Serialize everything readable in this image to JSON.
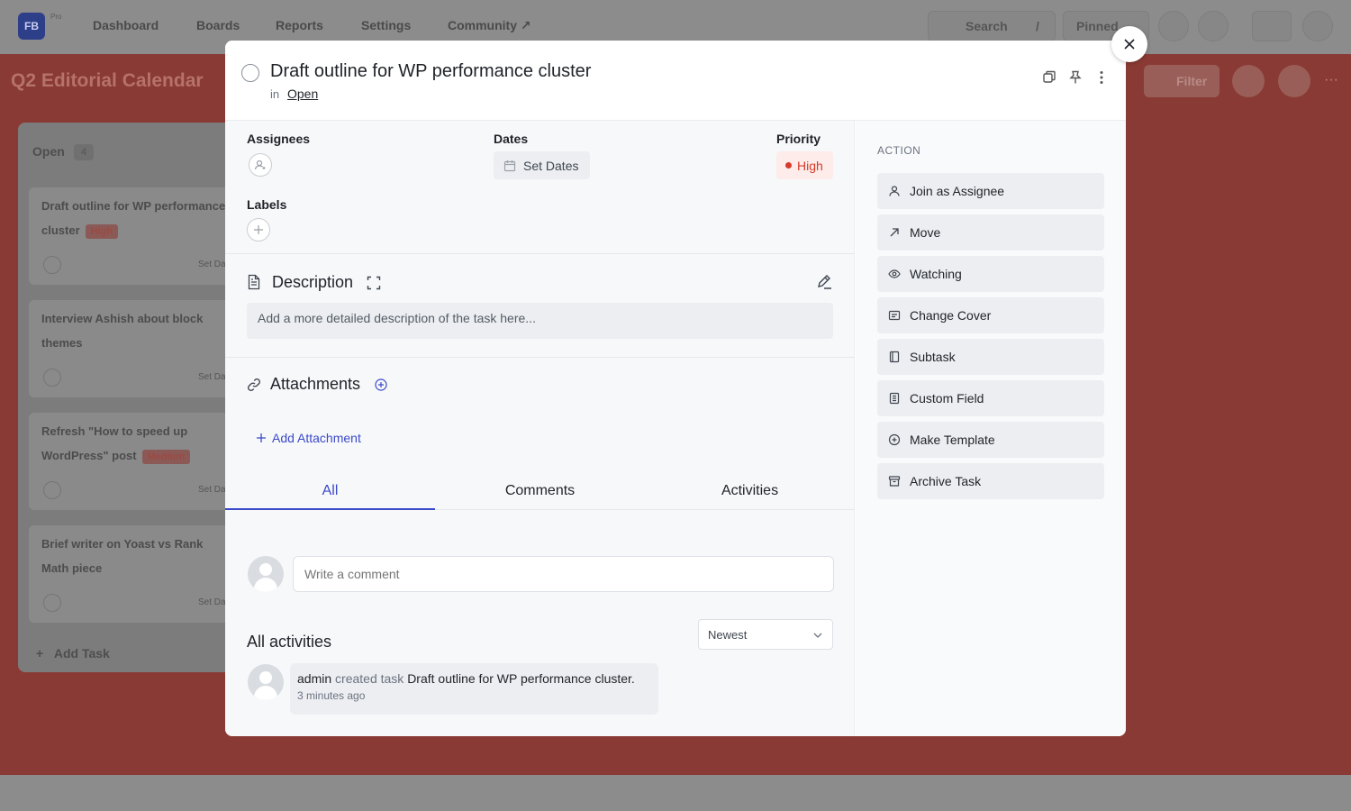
{
  "background": {
    "logo_pro": "Pro",
    "nav": [
      "Dashboard",
      "Boards",
      "Reports",
      "Settings",
      "Community ↗"
    ],
    "search_label": "Search",
    "search_shortcut": "/",
    "pinned_label": "Pinned",
    "board_title": "Q2 Editorial Calendar",
    "filter_label": "Filter",
    "column_title": "Open",
    "column_count": "4",
    "cards": [
      {
        "title": "Draft outline for WP performance cluster",
        "tag": "High"
      },
      {
        "title": "Interview Ashish about block themes",
        "tag": ""
      },
      {
        "title": "Refresh \"How to speed up WordPress\" post",
        "tag": "Medium"
      },
      {
        "title": "Brief writer on Yoast vs Rank Math piece",
        "tag": ""
      }
    ],
    "card_set_dates": "Set Da",
    "add_task": "Add Task"
  },
  "task": {
    "title": "Draft outline for WP performance cluster",
    "in_label": "in",
    "stage": "Open"
  },
  "fields": {
    "assignees_label": "Assignees",
    "dates_label": "Dates",
    "set_dates": "Set Dates",
    "priority_label": "Priority",
    "priority_value": "High",
    "labels_label": "Labels"
  },
  "description": {
    "title": "Description",
    "placeholder": "Add a more detailed description of the task here..."
  },
  "attachments": {
    "title": "Attachments",
    "add_label": "Add Attachment"
  },
  "tabs": [
    "All",
    "Comments",
    "Activities"
  ],
  "comment": {
    "placeholder": "Write a comment"
  },
  "activities": {
    "title": "All activities",
    "sort": "Newest",
    "items": [
      {
        "user": "admin",
        "verb": "created task",
        "target": "Draft outline for WP performance cluster.",
        "time": "3 minutes ago"
      }
    ]
  },
  "actions": {
    "heading": "ACTION",
    "items": [
      {
        "label": "Join as Assignee",
        "icon": "user-icon"
      },
      {
        "label": "Move",
        "icon": "arrow-up-right-icon"
      },
      {
        "label": "Watching",
        "icon": "eye-icon"
      },
      {
        "label": "Change Cover",
        "icon": "cover-icon"
      },
      {
        "label": "Subtask",
        "icon": "subtask-icon"
      },
      {
        "label": "Custom Field",
        "icon": "custom-field-icon"
      },
      {
        "label": "Make Template",
        "icon": "template-icon"
      },
      {
        "label": "Archive Task",
        "icon": "archive-icon"
      }
    ]
  },
  "colors": {
    "accent": "#3a49c8",
    "priority_high": "#d63a2a",
    "board_bg": "#8a3a34"
  }
}
